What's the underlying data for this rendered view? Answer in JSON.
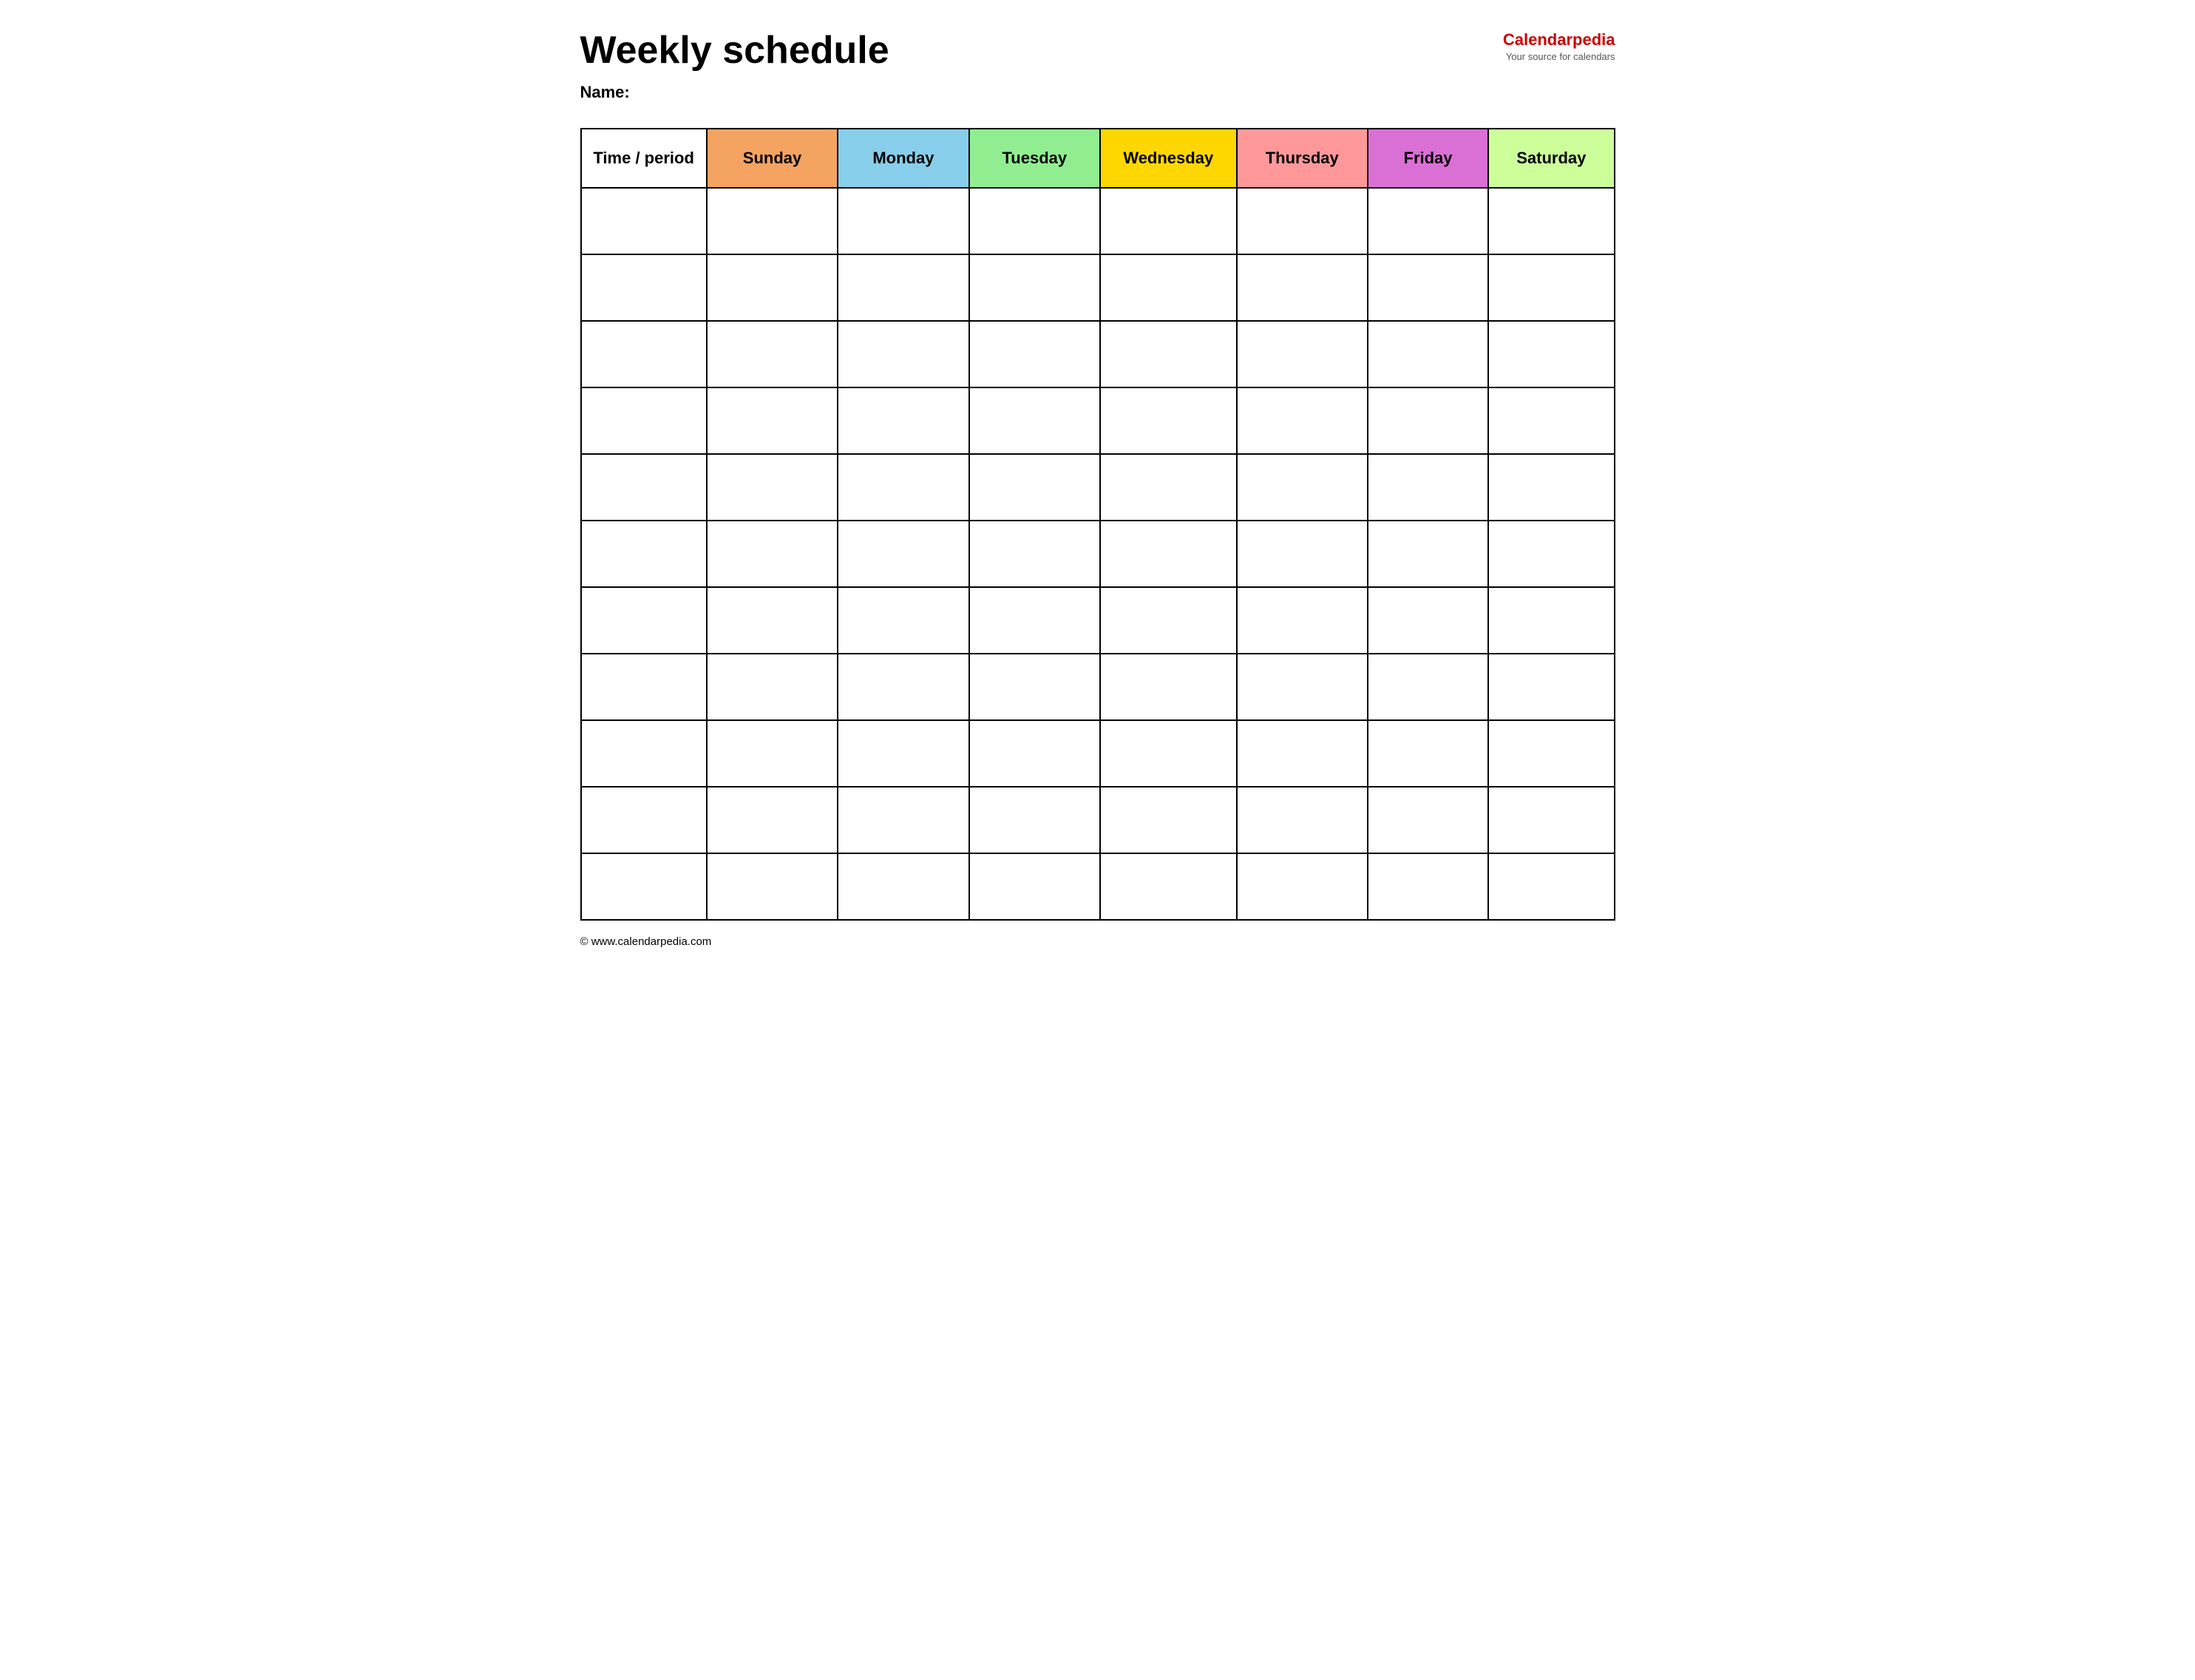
{
  "header": {
    "title": "Weekly schedule",
    "name_label": "Name:",
    "brand": {
      "name_part1": "Calendar",
      "name_part2": "pedia",
      "tagline": "Your source for calendars"
    }
  },
  "table": {
    "columns": [
      {
        "key": "time",
        "label": "Time / period",
        "color": "#ffffff",
        "class": "col-time"
      },
      {
        "key": "sunday",
        "label": "Sunday",
        "color": "#f4a460",
        "class": "col-sunday"
      },
      {
        "key": "monday",
        "label": "Monday",
        "color": "#87ceeb",
        "class": "col-monday"
      },
      {
        "key": "tuesday",
        "label": "Tuesday",
        "color": "#90ee90",
        "class": "col-tuesday"
      },
      {
        "key": "wednesday",
        "label": "Wednesday",
        "color": "#ffd700",
        "class": "col-wednesday"
      },
      {
        "key": "thursday",
        "label": "Thursday",
        "color": "#ff9999",
        "class": "col-thursday"
      },
      {
        "key": "friday",
        "label": "Friday",
        "color": "#da70d6",
        "class": "col-friday"
      },
      {
        "key": "saturday",
        "label": "Saturday",
        "color": "#ccff99",
        "class": "col-saturday"
      }
    ],
    "rows": 11
  },
  "footer": {
    "url": "© www.calendarpedia.com"
  }
}
